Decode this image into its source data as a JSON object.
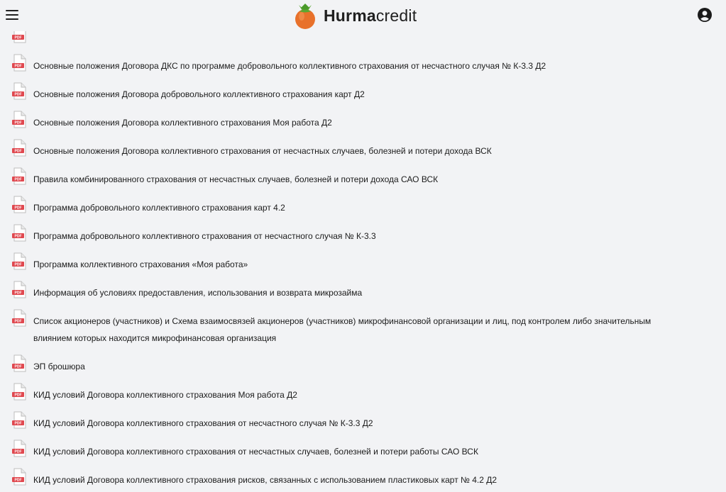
{
  "header": {
    "menu_icon": "hamburger-menu-icon",
    "logo_bold": "Hurma",
    "logo_light": "credit",
    "logo_icon": "persimmon-logo-icon",
    "account_icon": "user-circle-icon",
    "colors": {
      "background": "#f2f3f5",
      "logo_fruit": "#e8712b",
      "logo_leaf": "#5aa832",
      "pdf_badge": "#e0484f"
    }
  },
  "documents": [
    {
      "title": "",
      "icon": "pdf-file-icon",
      "badge": "PDF"
    },
    {
      "title": "Основные положения Договора ДКС по программе добровольного коллективного страхования от несчастного случая № К-3.3 Д2",
      "icon": "pdf-file-icon",
      "badge": "PDF"
    },
    {
      "title": "Основные положения Договора добровольного коллективного страхования карт Д2",
      "icon": "pdf-file-icon",
      "badge": "PDF"
    },
    {
      "title": "Основные положения Договора коллективного страхования Моя работа Д2",
      "icon": "pdf-file-icon",
      "badge": "PDF"
    },
    {
      "title": "Основные положения Договора коллективного страхования от несчастных случаев, болезней и потери дохода ВСК",
      "icon": "pdf-file-icon",
      "badge": "PDF"
    },
    {
      "title": "Правила комбинированного страхования от несчастных случаев, болезней и потери дохода САО ВСК",
      "icon": "pdf-file-icon",
      "badge": "PDF"
    },
    {
      "title": "Программа добровольного коллективного страхования карт 4.2",
      "icon": "pdf-file-icon",
      "badge": "PDF"
    },
    {
      "title": "Программа добровольного коллективного страхования от несчастного случая № К-3.3",
      "icon": "pdf-file-icon",
      "badge": "PDF"
    },
    {
      "title": "Программа коллективного страхования «Моя работа»",
      "icon": "pdf-file-icon",
      "badge": "PDF"
    },
    {
      "title": "Информация об условиях предоставления, использования и возврата микрозайма",
      "icon": "pdf-file-icon",
      "badge": "PDF"
    },
    {
      "title": "Список акционеров (участников) и Схема взаимосвязей акционеров (участников) микрофинансовой организации и лиц, под контролем либо значительным влиянием которых находится микрофинансовая организация",
      "icon": "pdf-file-icon",
      "badge": "PDF"
    },
    {
      "title": "ЭП брошюра",
      "icon": "pdf-file-icon",
      "badge": "PDF"
    },
    {
      "title": "КИД условий Договора коллективного страхования Моя работа Д2",
      "icon": "pdf-file-icon",
      "badge": "PDF"
    },
    {
      "title": "КИД условий Договора коллективного страхования от несчастного случая № К-3.3 Д2",
      "icon": "pdf-file-icon",
      "badge": "PDF"
    },
    {
      "title": "КИД условий Договора коллективного страхования от несчастных случаев, болезней и потери работы САО ВСК",
      "icon": "pdf-file-icon",
      "badge": "PDF"
    },
    {
      "title": "КИД условий Договора коллективного страхования рисков, связанных с использованием пластиковых карт № 4.2 Д2",
      "icon": "pdf-file-icon",
      "badge": "PDF"
    }
  ]
}
